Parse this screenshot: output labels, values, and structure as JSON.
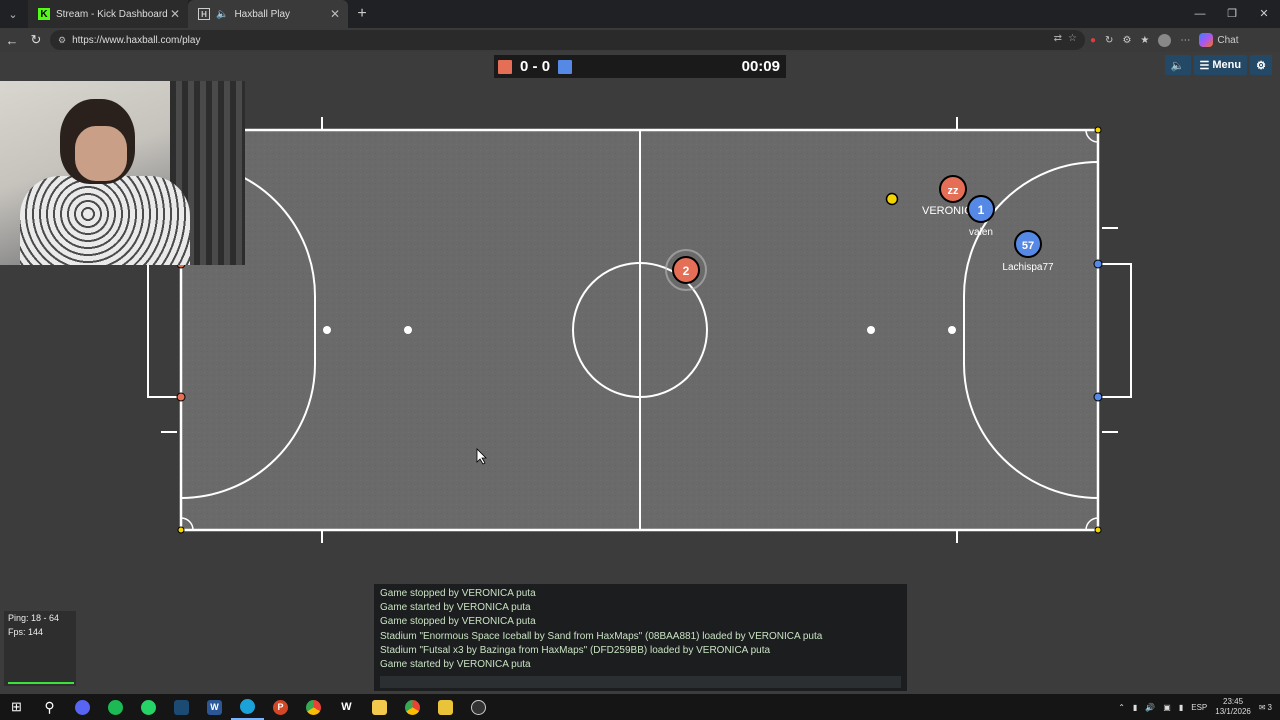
{
  "browser": {
    "tabs": [
      {
        "label": "Stream - Kick Dashboard",
        "icon": "kick-icon"
      },
      {
        "label": "Haxball Play",
        "icon": "haxball-icon"
      }
    ],
    "url": "https://www.haxball.com/play",
    "copilot_label": "Chat"
  },
  "game": {
    "score_red": "0",
    "score_separator": "-",
    "score_blue": "0",
    "timer": "00:09",
    "menu_label": "Menu",
    "players": [
      {
        "number": "2",
        "team": "red",
        "name": ""
      },
      {
        "number": "zz",
        "team": "red",
        "name": "VERONICA"
      },
      {
        "number": "1",
        "team": "blue",
        "name": "valen"
      },
      {
        "number": "57",
        "team": "blue",
        "name": "Lachispa77"
      }
    ],
    "colors": {
      "red": "#e56e56",
      "blue": "#5689e5",
      "ball": "#f3d400",
      "pitch": "#6b6b6b"
    }
  },
  "chat": {
    "messages": [
      "Game stopped by VERONICA puta",
      "Game started by VERONICA puta",
      "Game stopped by VERONICA puta",
      "Stadium \"Enormous Space Iceball by Sand from HaxMaps\" (08BAA881) loaded by VERONICA puta",
      "Stadium \"Futsal x3 by Bazinga from HaxMaps\" (DFD259BB) loaded by VERONICA puta",
      "Game started by VERONICA puta"
    ]
  },
  "stats": {
    "ping": "Ping: 18 - 64",
    "fps": "Fps: 144"
  },
  "taskbar": {
    "lang": "ESP",
    "time": "23:45",
    "date": "13/1/2026",
    "notifications": "3"
  }
}
